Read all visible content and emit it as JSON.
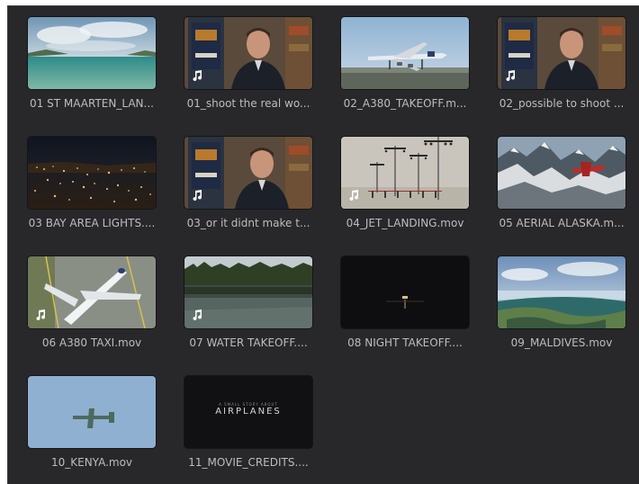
{
  "media_pool": {
    "clips": [
      {
        "name": "01 ST MAARTEN_LAN...",
        "thumb_icon": "beach-scene",
        "has_audio": false
      },
      {
        "name": "01_shoot the real wo...",
        "thumb_icon": "interview-scene",
        "has_audio": true
      },
      {
        "name": "02_A380_TAKEOFF.m...",
        "thumb_icon": "airplane-takeoff-scene",
        "has_audio": false
      },
      {
        "name": "02_possible to shoot ...",
        "thumb_icon": "interview-scene",
        "has_audio": true
      },
      {
        "name": "03 BAY AREA LIGHTS....",
        "thumb_icon": "city-lights-scene",
        "has_audio": false
      },
      {
        "name": "03_or it didnt make t...",
        "thumb_icon": "interview-scene",
        "has_audio": true
      },
      {
        "name": "04_JET_LANDING.mov",
        "thumb_icon": "approach-lights-scene",
        "has_audio": true
      },
      {
        "name": "05 AERIAL  ALASKA.m...",
        "thumb_icon": "mountain-plane-scene",
        "has_audio": false
      },
      {
        "name": "06 A380 TAXI.mov",
        "thumb_icon": "airplane-taxi-scene",
        "has_audio": true
      },
      {
        "name": "07 WATER TAKEOFF....",
        "thumb_icon": "lake-forest-scene",
        "has_audio": true
      },
      {
        "name": "08 NIGHT TAKEOFF....",
        "thumb_icon": "night-runway-scene",
        "has_audio": false
      },
      {
        "name": "09_MALDIVES.mov",
        "thumb_icon": "reef-scene",
        "has_audio": false
      },
      {
        "name": "10_KENYA.mov",
        "thumb_icon": "sky-plane-scene",
        "has_audio": false
      },
      {
        "name": "11_MOVIE_CREDITS....",
        "thumb_icon": "credits-title-scene",
        "has_audio": false,
        "thumb_text": "AIRPLANES",
        "thumb_subtext": "A SMALL STORY ABOUT"
      }
    ]
  }
}
